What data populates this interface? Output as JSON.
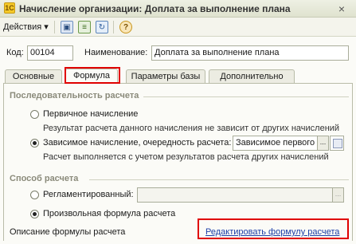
{
  "window": {
    "title": "Начисление организации: Доплата за выполнение плана",
    "close_icon": "×"
  },
  "toolbar": {
    "actions_label": "Действия",
    "actions_arrow": "▾",
    "help_glyph": "?"
  },
  "header": {
    "code_label": "Код:",
    "code_value": "00104",
    "name_label": "Наименование:",
    "name_value": "Доплата за выполнение плана"
  },
  "tabs": [
    {
      "label": "Основные",
      "active": false
    },
    {
      "label": "Формула",
      "active": true
    },
    {
      "label": "Параметры базы",
      "active": false
    },
    {
      "label": "Дополнительно",
      "active": false
    }
  ],
  "sequence": {
    "title": "Последовательность расчета",
    "option_primary": "Первичное начисление",
    "option_primary_desc": "Результат расчета данного начисления не зависит от других начислений",
    "option_dependent": "Зависимое начисление, очередность расчета:",
    "dependent_value": "Зависимое первого",
    "dependent_desc": "Расчет выполняется с учетом результатов расчета других начислений",
    "selected": "dependent"
  },
  "method": {
    "title": "Способ расчета",
    "option_regulated": "Регламентированный:",
    "regulated_value": "",
    "option_custom": "Произвольная формула расчета",
    "selected": "custom"
  },
  "formula": {
    "description_label": "Описание формулы расчета",
    "edit_link": "Редактировать формулу расчета"
  },
  "colors": {
    "highlight": "#e00000",
    "link": "#1c3fa8"
  },
  "icons": [
    "app-icon",
    "close-icon",
    "save-icon",
    "document-icon",
    "refresh-icon",
    "help-icon",
    "ellipsis-icon"
  ]
}
